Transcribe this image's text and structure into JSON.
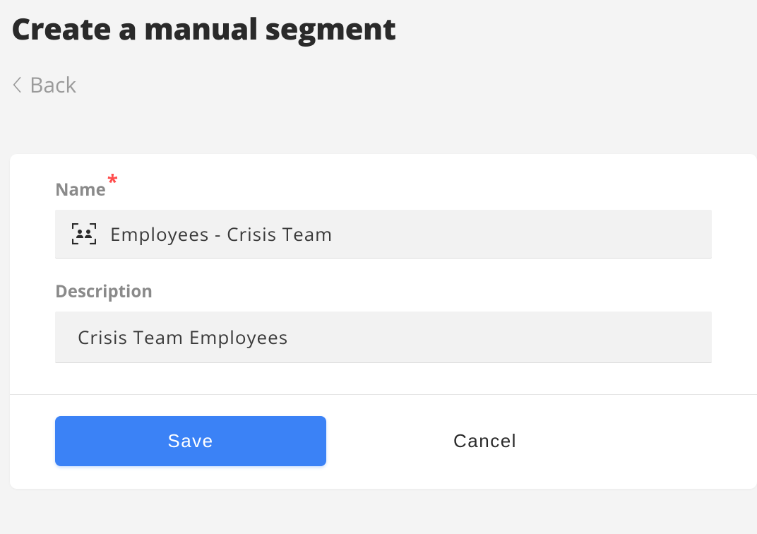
{
  "header": {
    "title": "Create a manual segment",
    "back_label": "Back"
  },
  "form": {
    "name": {
      "label": "Name",
      "required_marker": "*",
      "value": "Employees - Crisis Team"
    },
    "description": {
      "label": "Description",
      "value": "Crisis Team Employees"
    }
  },
  "actions": {
    "save_label": "Save",
    "cancel_label": "Cancel"
  }
}
